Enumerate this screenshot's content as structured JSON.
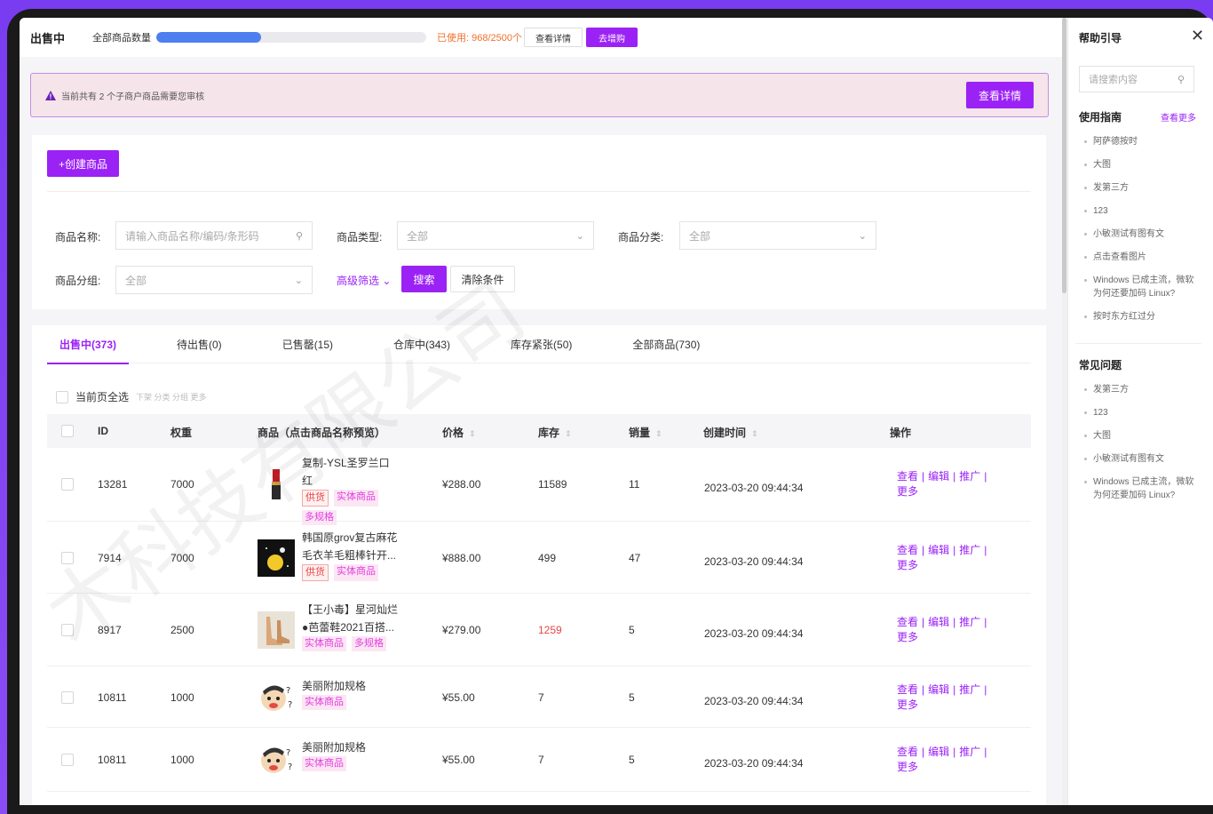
{
  "topbar": {
    "title": "出售中",
    "qty_label": "全部商品数量",
    "used": "已使用: 968/2500个",
    "used_fraction": 0.387,
    "details_btn": "查看详情",
    "buy_btn": "去增购"
  },
  "notice": {
    "text": "当前共有 2 个子商户商品需要您审核",
    "button": "查看详情"
  },
  "filters": {
    "create_btn": "+创建商品",
    "name_label": "商品名称:",
    "name_placeholder": "请输入商品名称/编码/条形码",
    "type_label": "商品类型:",
    "type_value": "全部",
    "category_label": "商品分类:",
    "category_value": "全部",
    "group_label": "商品分组:",
    "group_value": "全部",
    "advanced": "高级筛选",
    "search_btn": "搜索",
    "clear_btn": "清除条件"
  },
  "tabs": [
    "出售中(373)",
    "待出售(0)",
    "已售罄(15)",
    "仓库中(343)",
    "库存紧张(50)",
    "全部商品(730)"
  ],
  "select_all": {
    "label": "当前页全选",
    "ops": "下架 分类 分组 更多"
  },
  "table": {
    "headers": {
      "id": "ID",
      "weight": "权重",
      "product": "商品（点击商品名称预览）",
      "price": "价格",
      "stock": "库存",
      "sales": "销量",
      "created": "创建时间",
      "ops": "操作"
    },
    "ops": {
      "view": "查看",
      "edit": "编辑",
      "promote": "推广",
      "more": "更多"
    },
    "rows": [
      {
        "id": "13281",
        "weight": "7000",
        "name": "复制-YSL圣罗兰口红",
        "tags": [
          "供货",
          "实体商品",
          "多规格"
        ],
        "price": "¥288.00",
        "stock": "11589",
        "sales": "11",
        "created": "2023-03-20 09:44:34"
      },
      {
        "id": "7914",
        "weight": "7000",
        "name": "韩国原grov复古麻花毛衣羊毛粗棒针开...",
        "tags": [
          "供货",
          "实体商品"
        ],
        "price": "¥888.00",
        "stock": "499",
        "sales": "47",
        "created": "2023-03-20 09:44:34"
      },
      {
        "id": "8917",
        "weight": "2500",
        "name": "【王小毒】星河灿烂●芭蕾鞋2021百搭...",
        "tags": [
          "实体商品",
          "多规格"
        ],
        "price": "¥279.00",
        "stock": "1259",
        "sales": "5",
        "created": "2023-03-20 09:44:34"
      },
      {
        "id": "10811",
        "weight": "1000",
        "name": "美丽附加规格",
        "tags": [
          "实体商品"
        ],
        "price": "¥55.00",
        "stock": "7",
        "sales": "5",
        "created": "2023-03-20 09:44:34"
      },
      {
        "id": "10811",
        "weight": "1000",
        "name": "美丽附加规格",
        "tags": [
          "实体商品"
        ],
        "price": "¥55.00",
        "stock": "7",
        "sales": "5",
        "created": "2023-03-20 09:44:34"
      }
    ]
  },
  "watermark": "木科技有限公司",
  "side": {
    "title": "帮助引导",
    "search_placeholder": "请搜索内容",
    "guide_title": "使用指南",
    "guide_more": "查看更多",
    "guide_items": [
      "阿萨德按时",
      "大图",
      "发第三方",
      "123",
      "小敏测试有图有文",
      "点击查看图片",
      "Windows 已成主流，微软为何还要加码 Linux?",
      "按时东方红过分"
    ],
    "faq_title": "常见问题",
    "faq_items": [
      "发第三方",
      "123",
      "大图",
      "小敏测试有图有文",
      "Windows 已成主流，微软为何还要加码 Linux?"
    ]
  },
  "colors": {
    "accent": "#9b22f5",
    "progress": "#4e7ff0",
    "warning": "#f0712c",
    "danger": "#e84545"
  }
}
